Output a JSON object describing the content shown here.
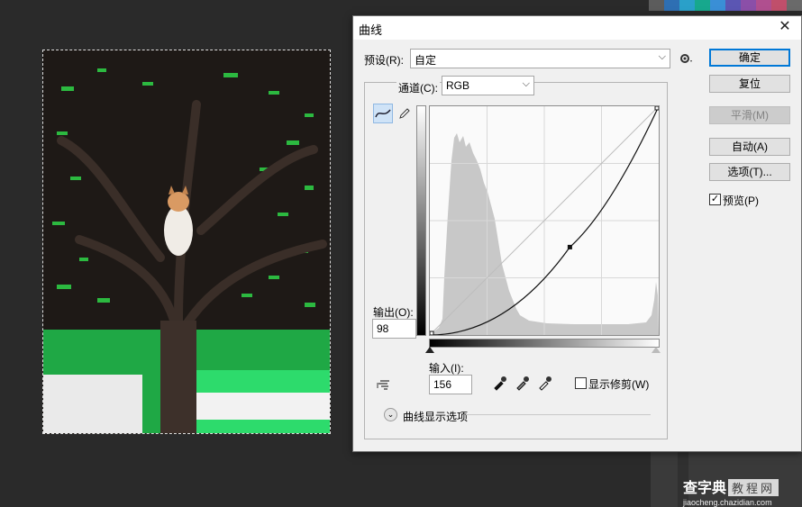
{
  "dialog": {
    "title": "曲线",
    "close_glyph": "✕",
    "preset_label": "预设(R):",
    "preset_value": "自定",
    "channel_label": "通道(C):",
    "channel_value": "RGB",
    "output_label": "输出(O):",
    "output_value": "98",
    "input_label": "输入(I):",
    "input_value": "156",
    "show_clipping_label": "显示修剪(W)",
    "show_clipping_checked": false,
    "curve_display_options": "曲线显示选项",
    "preview_label": "预览(P)",
    "preview_checked": true,
    "buttons": {
      "ok": "确定",
      "reset": "复位",
      "smooth": "平滑(M)",
      "auto": "自动(A)",
      "options": "选项(T)..."
    },
    "curve_point": {
      "input": 156,
      "output": 98
    }
  },
  "icons": {
    "gear": "gear-icon",
    "curve_tool": "curve-edit-icon",
    "pencil_tool": "pencil-icon",
    "hand_tool": "hand-adjust-icon",
    "eyedroppers": [
      "black-point-eyedropper-icon",
      "gray-point-eyedropper-icon",
      "white-point-eyedropper-icon"
    ]
  },
  "watermark": {
    "main": "查字典",
    "box": "教程网",
    "url": "jiaocheng.chazidian.com"
  },
  "colors": {
    "accent": "#0078d7",
    "histogram": "#c8c8c8"
  }
}
